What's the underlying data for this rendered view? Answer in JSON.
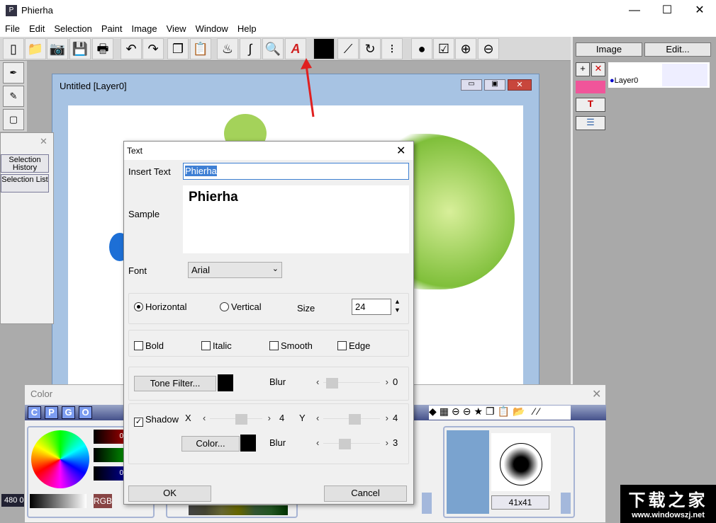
{
  "app": {
    "title": "Phierha",
    "controls": [
      "—",
      "☐",
      "✕"
    ]
  },
  "menu": [
    "File",
    "Edit",
    "Selection",
    "Paint",
    "Image",
    "View",
    "Window",
    "Help"
  ],
  "toolbar": {
    "icons": [
      "new-icon",
      "open-icon",
      "camera-icon",
      "save-icon",
      "print-icon",
      "undo-icon",
      "redo-icon",
      "copy-icon",
      "paste-icon",
      "paint-fill-icon",
      "paint-stroke-icon",
      "magnifier-icon",
      "text-icon",
      "color-swatch",
      "curves-icon",
      "transform-icon",
      "mask-icon",
      "sphere-icon",
      "checklist-icon",
      "zoom-in-icon",
      "zoom-out-icon"
    ],
    "glyphs": [
      "▯",
      "📁",
      "📷",
      "💾",
      "🖶",
      "↶",
      "↷",
      "❐",
      "📋",
      "♨",
      "∫",
      "🔍",
      "A",
      "",
      "⟋",
      "↻",
      "⁝",
      "●",
      "☑",
      "⊕",
      "⊖"
    ],
    "current_color": "#000000"
  },
  "right_panel": {
    "image_btn": "Image",
    "edit_btn": "Edit...",
    "layer_name": "Layer0",
    "fill_color": "#f0559a"
  },
  "document": {
    "title": "Untitled [Layer0]"
  },
  "selection_panel": {
    "buttons": [
      "Selection History",
      "Selection List"
    ]
  },
  "status": {
    "size": "480 0"
  },
  "text_dialog": {
    "title": "Text",
    "insert_label": "Insert Text",
    "insert_value": "Phierha",
    "sample_label": "Sample",
    "sample_text": "Phierha",
    "font_label": "Font",
    "font_value": "Arial",
    "horizontal": "Horizontal",
    "vertical": "Vertical",
    "orientation": "Horizontal",
    "size_label": "Size",
    "size_value": "24",
    "bold": "Bold",
    "italic": "Italic",
    "smooth": "Smooth",
    "edge": "Edge",
    "tone_filter": "Tone Filter...",
    "blur_label": "Blur",
    "blur_value": "0",
    "shadow": "Shadow",
    "shadow_checked": true,
    "x_label": "X",
    "x_value": "4",
    "y_label": "Y",
    "y_value": "4",
    "color_btn": "Color...",
    "shadow_blur_value": "3",
    "ok": "OK",
    "cancel": "Cancel"
  },
  "color_panel": {
    "title": "Color",
    "tabs": [
      "C",
      "P",
      "G",
      "O"
    ],
    "r": "0",
    "g": "0",
    "b": "0",
    "mode": "RGB",
    "brush_size": "41x41",
    "palette_index": "0"
  },
  "watermark": {
    "cn": "下载之家",
    "url": "www.windowszj.net"
  }
}
